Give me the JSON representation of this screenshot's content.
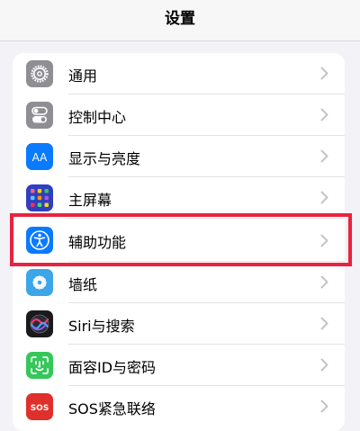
{
  "nav": {
    "title": "设置"
  },
  "settings": {
    "items": [
      {
        "id": "general",
        "label": "通用",
        "icon": "gear-icon",
        "color": "#8e8e93"
      },
      {
        "id": "control-center",
        "label": "控制中心",
        "icon": "toggles-icon",
        "color": "#8e8e93"
      },
      {
        "id": "display",
        "label": "显示与亮度",
        "icon": "text-size-icon",
        "color": "#0a7aff",
        "icon_text": "AA"
      },
      {
        "id": "home-screen",
        "label": "主屏幕",
        "icon": "app-grid-icon",
        "color": "#2f3fbf"
      },
      {
        "id": "accessibility",
        "label": "辅助功能",
        "icon": "accessibility-icon",
        "color": "#0a7aff",
        "highlighted": true
      },
      {
        "id": "wallpaper",
        "label": "墙纸",
        "icon": "flower-icon",
        "color": "#3ba6e8"
      },
      {
        "id": "siri",
        "label": "Siri与搜索",
        "icon": "siri-icon",
        "color": "#1a1a1a"
      },
      {
        "id": "face-id",
        "label": "面容ID与密码",
        "icon": "face-id-icon",
        "color": "#34c759"
      },
      {
        "id": "sos",
        "label": "SOS紧急联络",
        "icon": "sos-icon",
        "color": "#e0302b",
        "icon_text": "SOS"
      }
    ]
  },
  "colors": {
    "highlight_border": "#e8233f",
    "background": "#f2f2f7",
    "chevron": "#c4c4c7"
  }
}
